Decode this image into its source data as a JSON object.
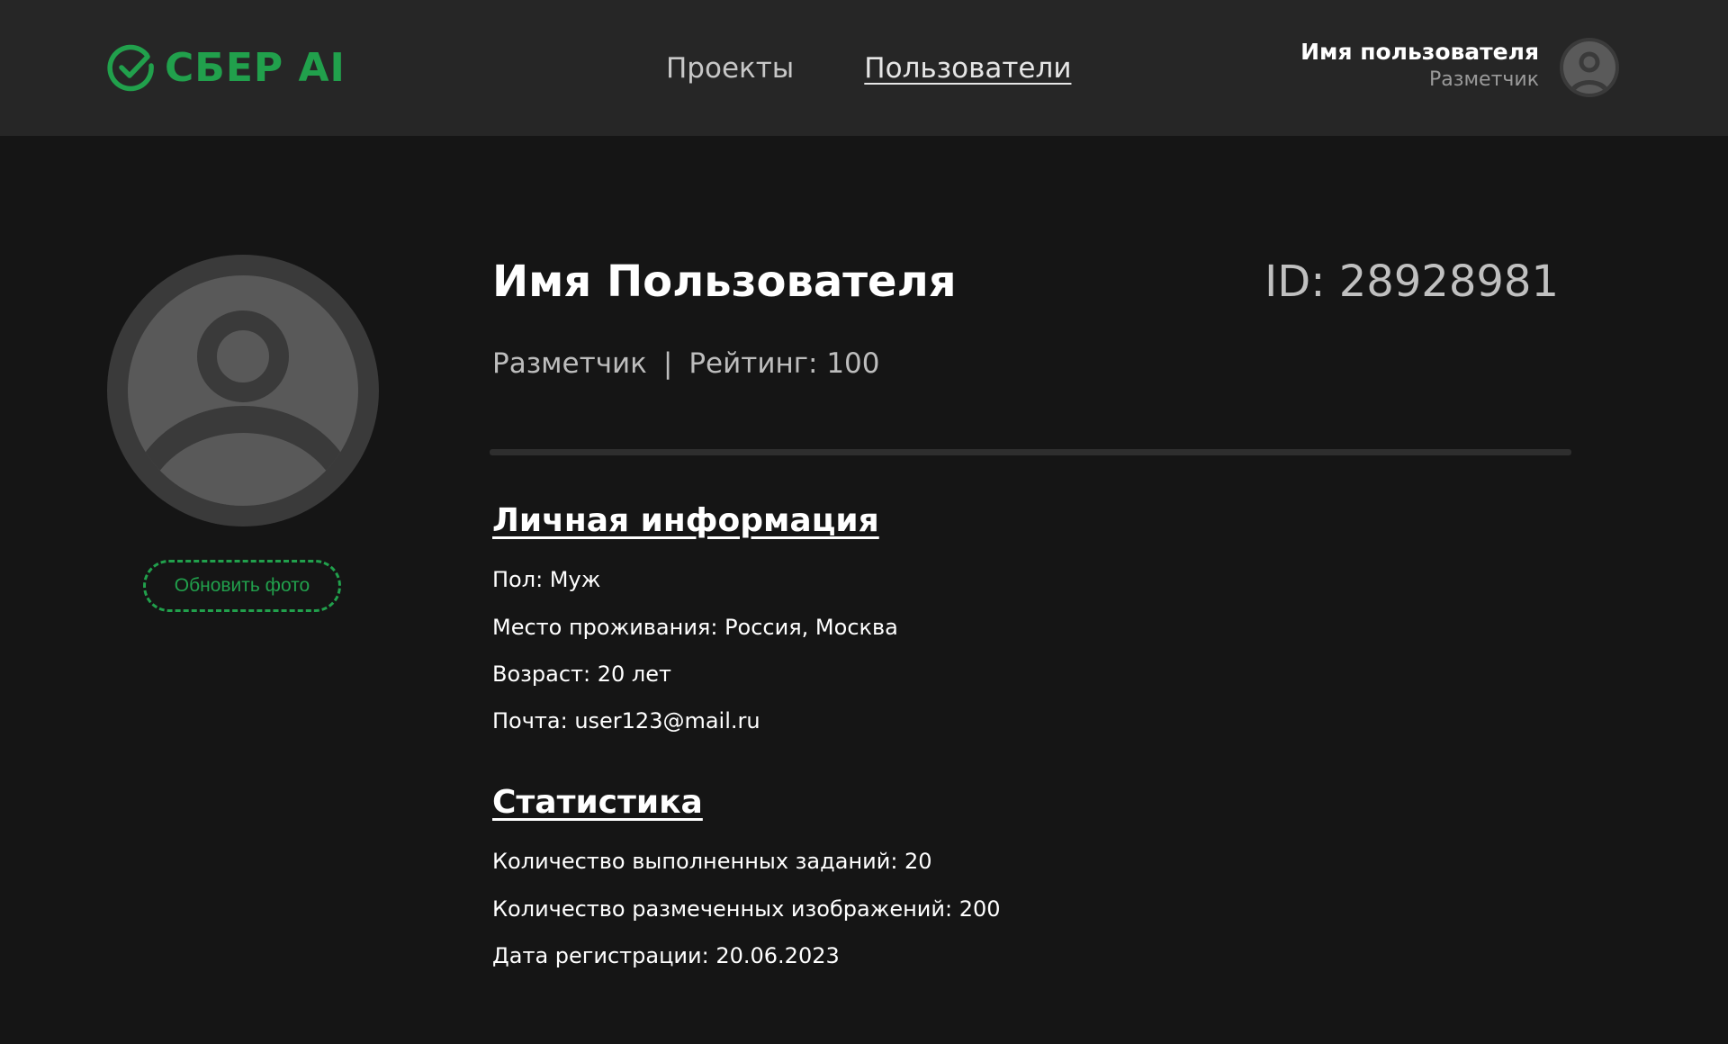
{
  "header": {
    "logo_text": "СБЕР AI",
    "nav": [
      {
        "label": "Проекты",
        "active": false
      },
      {
        "label": "Пользователи",
        "active": true
      }
    ],
    "user": {
      "name": "Имя пользователя",
      "role": "Разметчик"
    }
  },
  "profile": {
    "name": "Имя Пользователя",
    "id_text": "ID: 28928981",
    "role": "Разметчик",
    "separator": "|",
    "rating": "Рейтинг: 100",
    "update_photo_label": "Обновить фото"
  },
  "personal": {
    "title": "Личная информация",
    "lines": [
      "Пол: Муж",
      "Место проживания: Россия, Москва",
      "Возраст: 20 лет",
      "Почта: user123@mail.ru"
    ]
  },
  "stats": {
    "title": "Статистика",
    "lines": [
      "Количество выполненных заданий: 20",
      "Количество размеченных изображений: 200",
      "Дата регистрации: 20.06.2023"
    ]
  },
  "colors": {
    "accent": "#21a04c",
    "header_bg": "#262626",
    "page_bg": "#151515"
  },
  "icons": {
    "logo": "sber-check-icon",
    "avatar": "user-avatar-icon"
  }
}
